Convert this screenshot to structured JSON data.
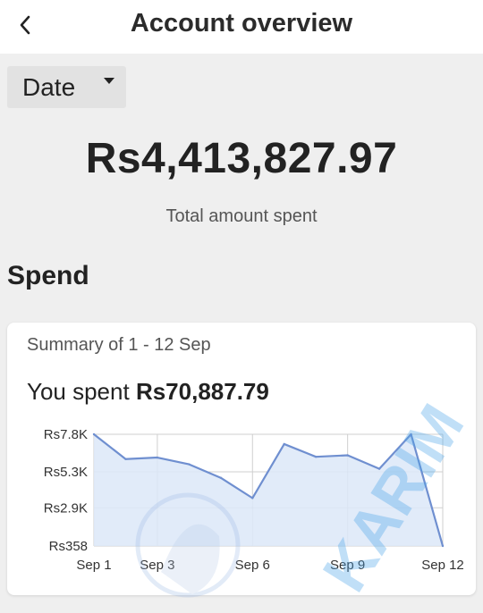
{
  "header": {
    "title": "Account overview",
    "back_icon": "chevron-left-icon"
  },
  "filter": {
    "date_label": "Date",
    "caret_icon": "caret-down-icon"
  },
  "totals": {
    "amount": "Rs4,413,827.97",
    "caption": "Total amount spent"
  },
  "spend": {
    "section_title": "Spend",
    "summary": "Summary of 1 - 12 Sep",
    "you_spent_prefix": "You spent ",
    "you_spent_amount": "Rs70,887.79"
  },
  "watermark": {
    "text": "KARIM"
  },
  "chart_data": {
    "type": "area",
    "x": [
      1,
      2,
      3,
      4,
      5,
      6,
      7,
      8,
      9,
      10,
      11,
      12
    ],
    "y_ticks": [
      {
        "label": "Rs7.8K",
        "value": 7800
      },
      {
        "label": "Rs5.3K",
        "value": 5300
      },
      {
        "label": "Rs2.9K",
        "value": 2900
      },
      {
        "label": "Rs358",
        "value": 358
      }
    ],
    "x_ticks": [
      {
        "label": "Sep 1",
        "value": 1
      },
      {
        "label": "Sep 3",
        "value": 3
      },
      {
        "label": "Sep 6",
        "value": 6
      },
      {
        "label": "Sep 9",
        "value": 9
      },
      {
        "label": "Sep 12",
        "value": 12
      }
    ],
    "values": [
      7800,
      6150,
      6250,
      5800,
      4900,
      3550,
      7150,
      6300,
      6400,
      5500,
      7800,
      358
    ],
    "ylim": [
      358,
      7800
    ],
    "xlim": [
      1,
      12
    ],
    "line_color": "#6f8fd0",
    "fill_color": "#dce7f8",
    "grid_color": "#cfcfcf",
    "grid": true
  }
}
